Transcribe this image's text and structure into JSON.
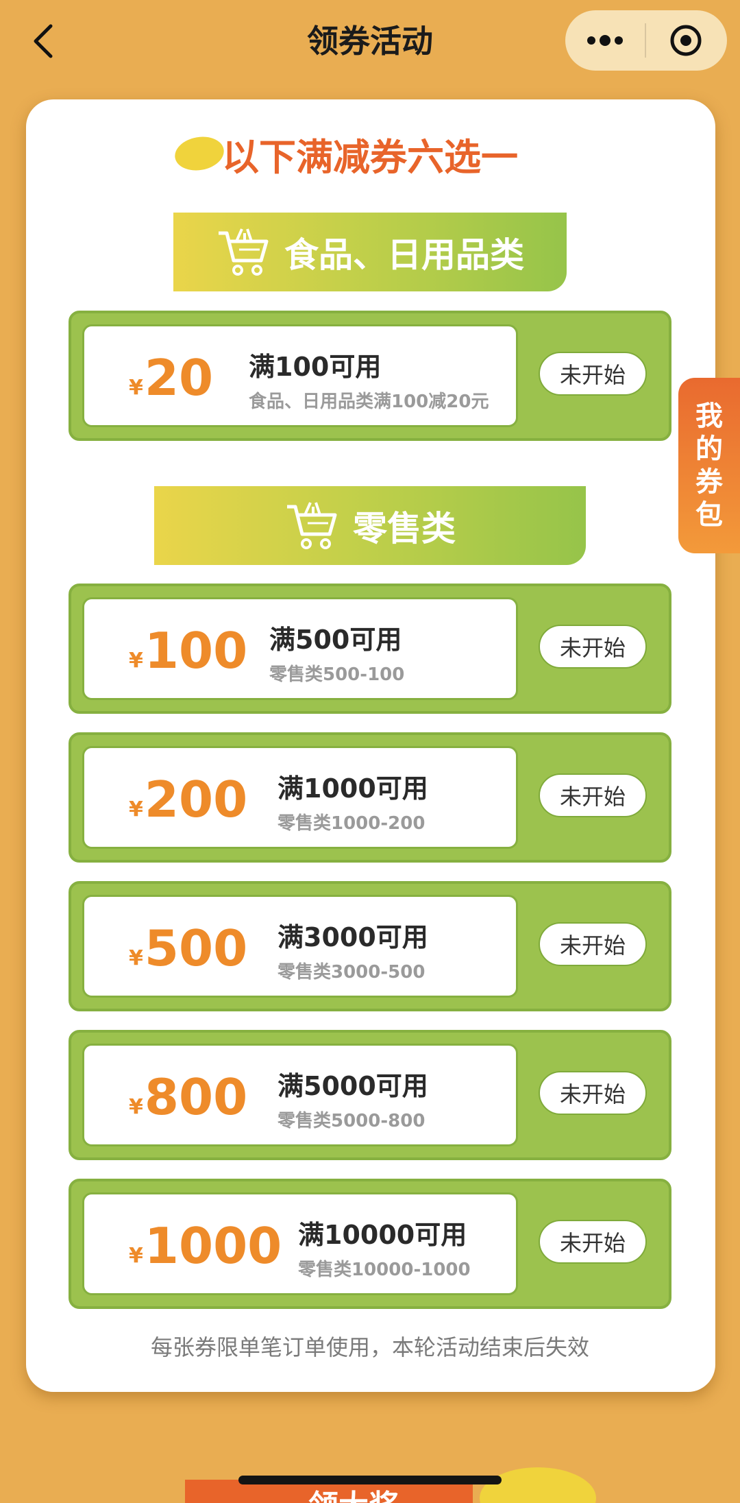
{
  "header": {
    "title": "领券活动",
    "back_icon": "chevron-left-icon",
    "menu_icon": "more-dots-icon",
    "close_icon": "target-close-icon"
  },
  "card": {
    "heading": "以下满减券六选一",
    "footer_note": "每张券限单笔订单使用，本轮活动结束后失效"
  },
  "categories": [
    {
      "label": "食品、日用品类",
      "icon": "shopping-cart-icon",
      "coupons": [
        {
          "currency": "¥",
          "amount": "20",
          "title": "满100可用",
          "desc": "食品、日用品类满100减20元",
          "status": "未开始"
        }
      ]
    },
    {
      "label": "零售类",
      "icon": "shopping-cart-icon",
      "coupons": [
        {
          "currency": "¥",
          "amount": "100",
          "title": "满500可用",
          "desc": "零售类500-100",
          "status": "未开始"
        },
        {
          "currency": "¥",
          "amount": "200",
          "title": "满1000可用",
          "desc": "零售类1000-200",
          "status": "未开始"
        },
        {
          "currency": "¥",
          "amount": "500",
          "title": "满3000可用",
          "desc": "零售类3000-500",
          "status": "未开始"
        },
        {
          "currency": "¥",
          "amount": "800",
          "title": "满5000可用",
          "desc": "零售类5000-800",
          "status": "未开始"
        },
        {
          "currency": "¥",
          "amount": "1000",
          "title": "满10000可用",
          "desc": "零售类10000-1000",
          "status": "未开始"
        }
      ]
    }
  ],
  "side_tab": {
    "label_chars": [
      "我",
      "的",
      "券",
      "包"
    ]
  },
  "bottom": {
    "partial_text": "领大奖"
  },
  "colors": {
    "background": "#e9ad52",
    "accent_orange": "#e8642a",
    "coupon_green": "#9cc24e",
    "amount_orange": "#ee8b2a"
  }
}
